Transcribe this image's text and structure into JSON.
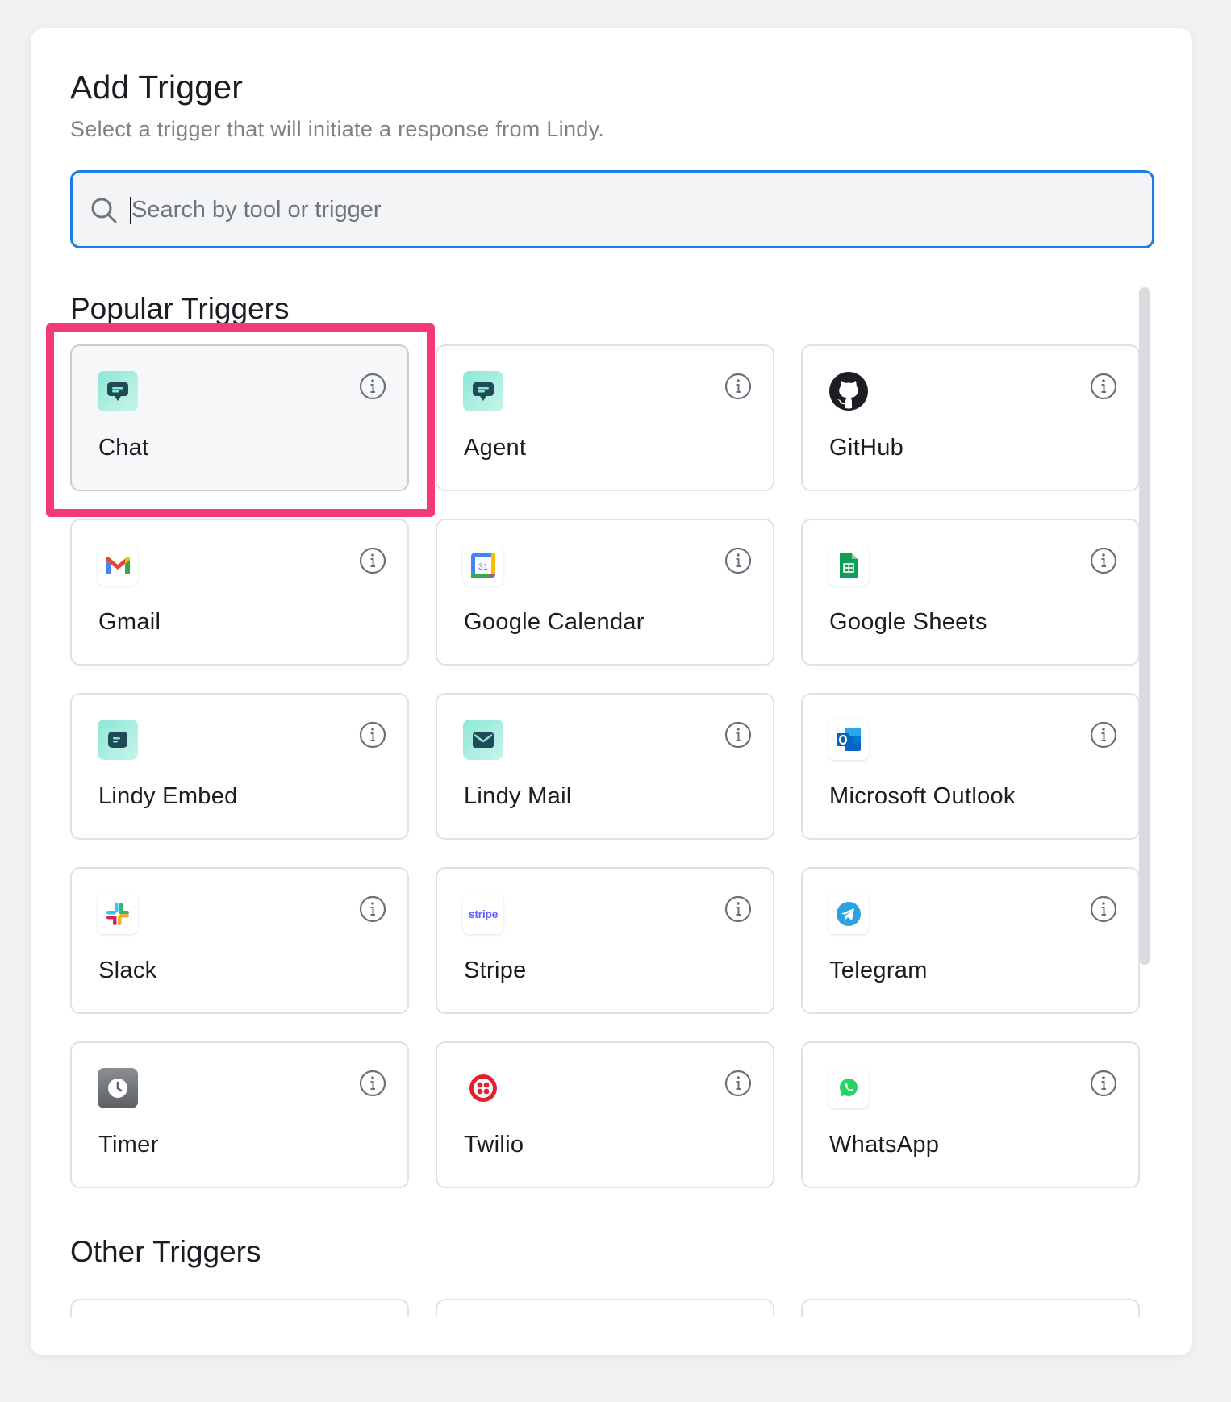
{
  "dialog": {
    "title": "Add Trigger",
    "subtitle": "Select a trigger that will initiate a response from Lindy."
  },
  "search": {
    "placeholder": "Search by tool or trigger",
    "value": "",
    "icon": "search-icon"
  },
  "sections": {
    "popular": "Popular Triggers",
    "other": "Other Triggers"
  },
  "popular_triggers": [
    {
      "label": "Chat",
      "icon": "chat-icon",
      "selected": true
    },
    {
      "label": "Agent",
      "icon": "agent-icon",
      "selected": false
    },
    {
      "label": "GitHub",
      "icon": "github-icon",
      "selected": false
    },
    {
      "label": "Gmail",
      "icon": "gmail-icon",
      "selected": false
    },
    {
      "label": "Google Calendar",
      "icon": "google-calendar-icon",
      "selected": false
    },
    {
      "label": "Google Sheets",
      "icon": "google-sheets-icon",
      "selected": false
    },
    {
      "label": "Lindy Embed",
      "icon": "lindy-embed-icon",
      "selected": false
    },
    {
      "label": "Lindy Mail",
      "icon": "lindy-mail-icon",
      "selected": false
    },
    {
      "label": "Microsoft Outlook",
      "icon": "outlook-icon",
      "selected": false
    },
    {
      "label": "Slack",
      "icon": "slack-icon",
      "selected": false
    },
    {
      "label": "Stripe",
      "icon": "stripe-icon",
      "selected": false
    },
    {
      "label": "Telegram",
      "icon": "telegram-icon",
      "selected": false
    },
    {
      "label": "Timer",
      "icon": "timer-icon",
      "selected": false
    },
    {
      "label": "Twilio",
      "icon": "twilio-icon",
      "selected": false
    },
    {
      "label": "WhatsApp",
      "icon": "whatsapp-icon",
      "selected": false
    }
  ],
  "colors": {
    "accent": "#1e7ce8",
    "highlight": "#f23a75"
  },
  "icon_text": {
    "calendar_day": "31",
    "stripe": "stripe"
  }
}
